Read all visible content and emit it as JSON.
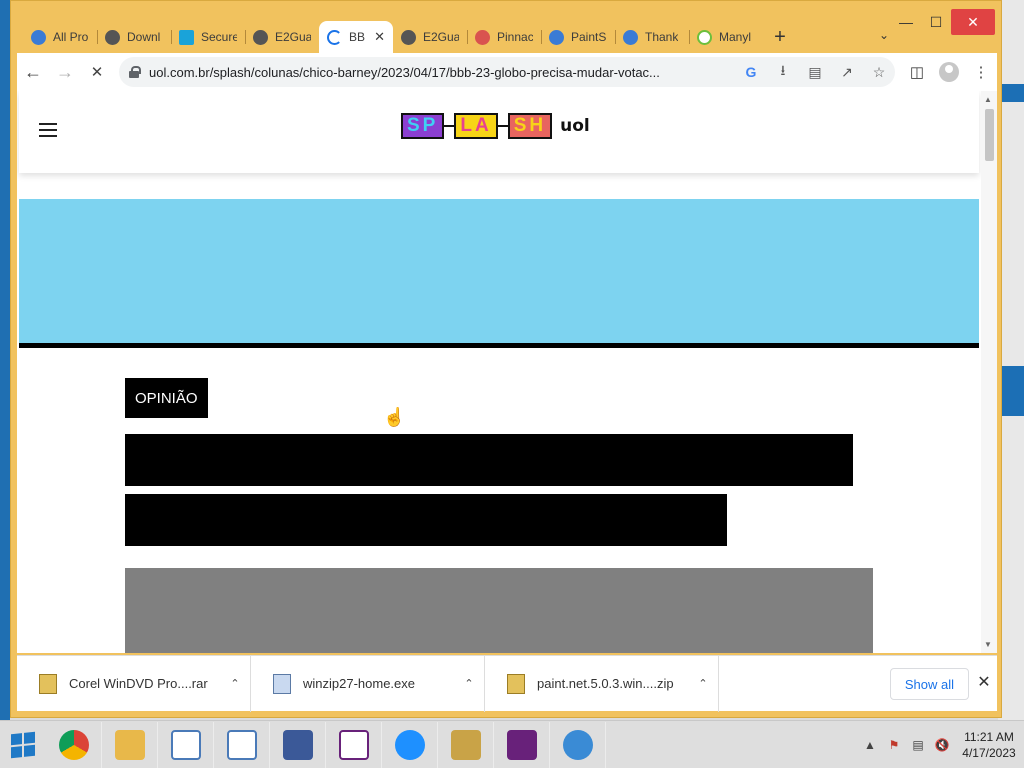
{
  "tabs": [
    {
      "title": "All Pro",
      "icon": "chrome-ext-icon",
      "color": "#3a7bd5"
    },
    {
      "title": "Downl",
      "icon": "globe-icon",
      "color": "#555555"
    },
    {
      "title": "Secure",
      "icon": "cube-icon",
      "color": "#1aa3d9"
    },
    {
      "title": "E2Guar",
      "icon": "globe-icon",
      "color": "#555555"
    },
    {
      "title": "BB",
      "icon": "loading-spinner-icon",
      "color": "#1a73e8",
      "active": true
    },
    {
      "title": "E2Guar",
      "icon": "globe-icon",
      "color": "#555555"
    },
    {
      "title": "Pinnac",
      "icon": "pinnacle-icon",
      "color": "#d9534f"
    },
    {
      "title": "PaintS",
      "icon": "paint-icon",
      "color": "#3a7bd5"
    },
    {
      "title": "Thank",
      "icon": "paint-icon",
      "color": "#3a7bd5"
    },
    {
      "title": "Manyl",
      "icon": "circle-check-icon",
      "color": "#6cbf3c"
    }
  ],
  "toolbar": {
    "url": "uol.com.br/splash/colunas/chico-barney/2023/04/17/bbb-23-globo-precisa-mudar-votac..."
  },
  "page": {
    "logo_letters": [
      "SP",
      "LA",
      "SH"
    ],
    "logo_colors": [
      "#8b3fd1",
      "#f7d417",
      "#e8655f"
    ],
    "logo_text_colors": [
      "#3fd0f3",
      "#e8408f",
      "#f7d417"
    ],
    "logo_uol": "uol",
    "badge": "OPINIÃO",
    "banner_color": "#7dd3f0"
  },
  "downloads": [
    {
      "name": "Corel WinDVD Pro....rar",
      "type": "archive"
    },
    {
      "name": "winzip27-home.exe",
      "type": "exe"
    },
    {
      "name": "paint.net.5.0.3.win....zip",
      "type": "archive"
    }
  ],
  "downloads_bar": {
    "show_all": "Show all"
  },
  "taskbar": {
    "apps": [
      {
        "name": "chrome",
        "color": "#e04a3a"
      },
      {
        "name": "file-explorer",
        "color": "#e8b84a"
      },
      {
        "name": "app-window",
        "color": "#4a7ab8"
      },
      {
        "name": "app-window-2",
        "color": "#4a7ab8"
      },
      {
        "name": "paint",
        "color": "#3b5998"
      },
      {
        "name": "visual-studio-installer",
        "color": "#68217a"
      },
      {
        "name": "internet-explorer",
        "color": "#1e90ff"
      },
      {
        "name": "archive-app",
        "color": "#c9a347"
      },
      {
        "name": "visual-studio",
        "color": "#68217a"
      },
      {
        "name": "paint-net",
        "color": "#3a8bd5"
      }
    ],
    "time": "11:21 AM",
    "date": "4/17/2023"
  }
}
